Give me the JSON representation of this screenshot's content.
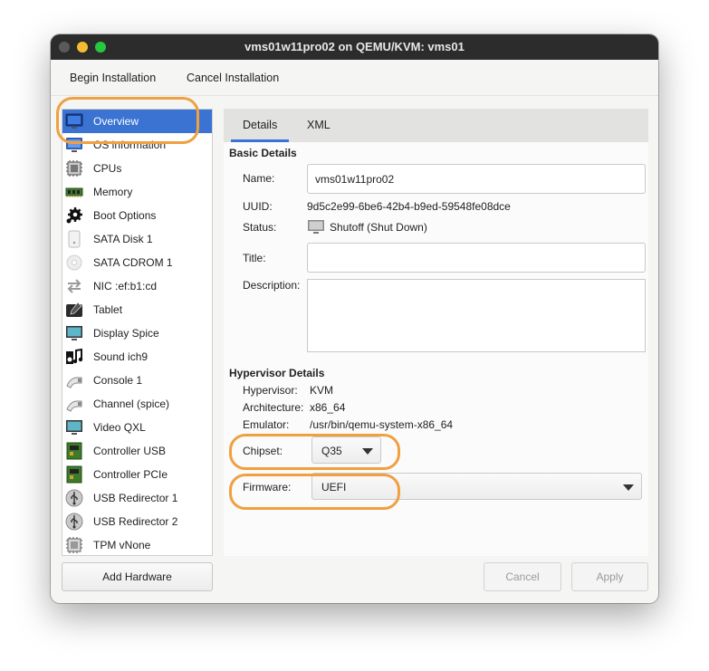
{
  "window": {
    "title": "vms01w11pro02 on QEMU/KVM: vms01"
  },
  "menubar": {
    "begin_installation": "Begin Installation",
    "cancel_installation": "Cancel Installation"
  },
  "hardware_list": [
    {
      "label": "Overview",
      "icon": "monitor-icon",
      "selected": true
    },
    {
      "label": "OS information",
      "icon": "os-info-icon"
    },
    {
      "label": "CPUs",
      "icon": "cpu-icon"
    },
    {
      "label": "Memory",
      "icon": "memory-icon"
    },
    {
      "label": "Boot Options",
      "icon": "gear-icon"
    },
    {
      "label": "SATA Disk 1",
      "icon": "disk-icon"
    },
    {
      "label": "SATA CDROM 1",
      "icon": "cdrom-icon"
    },
    {
      "label": "NIC :ef:b1:cd",
      "icon": "network-icon"
    },
    {
      "label": "Tablet",
      "icon": "tablet-icon"
    },
    {
      "label": "Display Spice",
      "icon": "display-icon"
    },
    {
      "label": "Sound ich9",
      "icon": "sound-icon"
    },
    {
      "label": "Console 1",
      "icon": "serial-icon"
    },
    {
      "label": "Channel (spice)",
      "icon": "serial-icon"
    },
    {
      "label": "Video QXL",
      "icon": "video-icon"
    },
    {
      "label": "Controller USB",
      "icon": "controller-icon"
    },
    {
      "label": "Controller PCIe",
      "icon": "controller-icon"
    },
    {
      "label": "USB Redirector 1",
      "icon": "usb-icon"
    },
    {
      "label": "USB Redirector 2",
      "icon": "usb-icon"
    },
    {
      "label": "TPM vNone",
      "icon": "chip-icon"
    }
  ],
  "buttons": {
    "add_hardware": "Add Hardware",
    "cancel": "Cancel",
    "apply": "Apply"
  },
  "tabs": {
    "details": "Details",
    "xml": "XML"
  },
  "basic_details": {
    "heading": "Basic Details",
    "name_label": "Name:",
    "name_value": "vms01w11pro02",
    "uuid_label": "UUID:",
    "uuid_value": "9d5c2e99-6be6-42b4-b9ed-59548fe08dce",
    "status_label": "Status:",
    "status_value": "Shutoff (Shut Down)",
    "title_label": "Title:",
    "title_value": "",
    "description_label": "Description:",
    "description_value": ""
  },
  "hypervisor_details": {
    "heading": "Hypervisor Details",
    "hypervisor_label": "Hypervisor:",
    "hypervisor_value": "KVM",
    "architecture_label": "Architecture:",
    "architecture_value": "x86_64",
    "emulator_label": "Emulator:",
    "emulator_value": "/usr/bin/qemu-system-x86_64",
    "chipset_label": "Chipset:",
    "chipset_value": "Q35",
    "firmware_label": "Firmware:",
    "firmware_value": "UEFI"
  },
  "colors": {
    "selection": "#3a73d2",
    "highlight_annotation": "#f0a040",
    "titlebar": "#2c2c2c"
  }
}
